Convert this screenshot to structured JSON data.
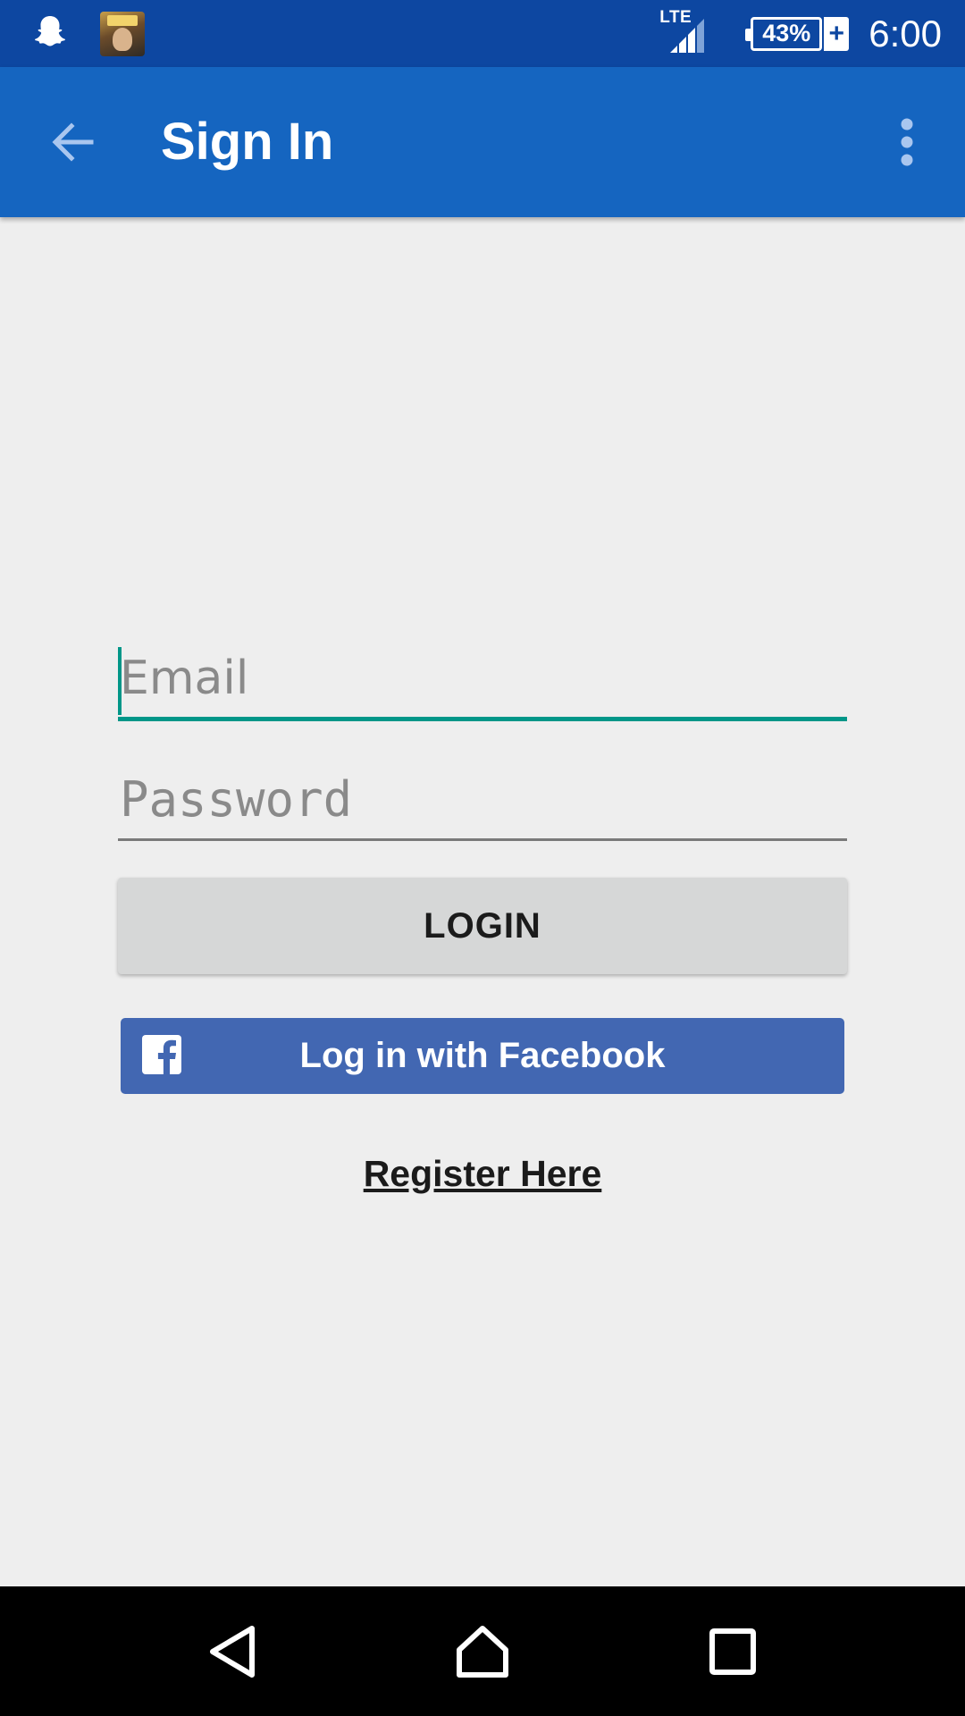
{
  "status_bar": {
    "network_type": "LTE",
    "battery_percent": "43%",
    "charging_symbol": "+",
    "time": "6:00",
    "notifications": [
      "snapchat-icon",
      "game-app-icon"
    ]
  },
  "app_bar": {
    "title": "Sign In",
    "back_icon": "arrow-back-icon",
    "menu_icon": "more-vert-icon"
  },
  "form": {
    "email_placeholder": "Email",
    "email_value": "",
    "password_placeholder": "Password",
    "password_value": "",
    "login_label": "LOGIN",
    "facebook_label": "Log in with Facebook",
    "register_label": "Register Here"
  },
  "nav_bar": {
    "buttons": [
      "back-triangle-icon",
      "home-icon",
      "recents-square-icon"
    ]
  },
  "colors": {
    "status_bar": "#0d47a1",
    "app_bar": "#1565c0",
    "accent": "#009688",
    "facebook": "#4267b2",
    "background": "#eeeeee"
  }
}
